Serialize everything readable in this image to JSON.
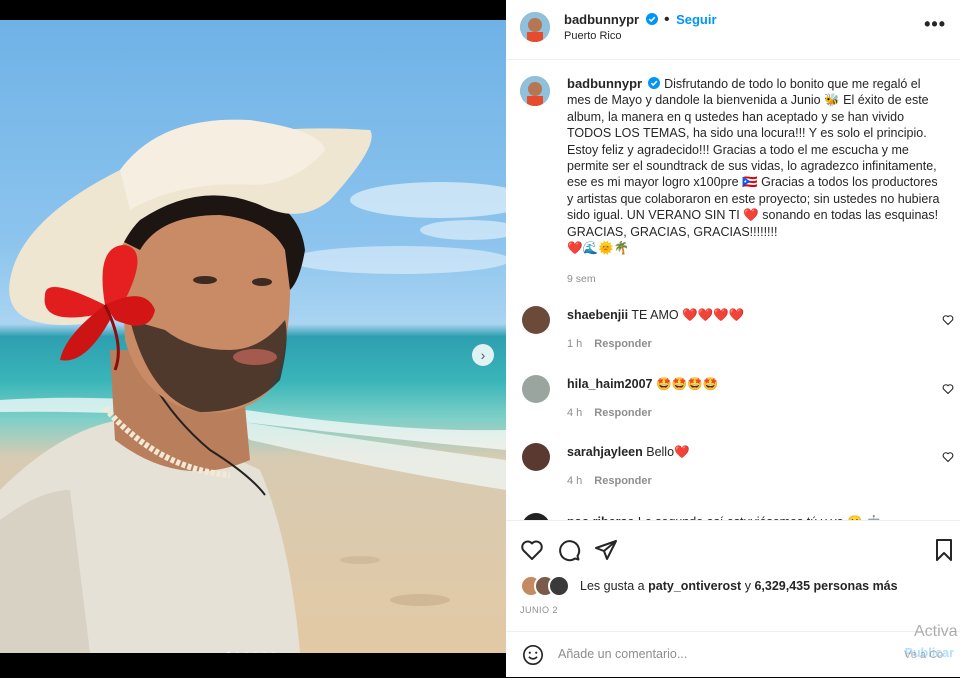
{
  "post": {
    "username": "badbunnypr",
    "follow_label": "Seguir",
    "location": "Puerto Rico",
    "more_label": "•••",
    "caption": "Disfrutando de todo lo bonito que me regaló el mes de Mayo y dandole la bienvenida a Junio 🐝 El éxito de este album, la manera en q ustedes han aceptado y se han vivido TODOS LOS TEMAS, ha sido una locura!!! Y es solo el principio. Estoy feliz y agradecido!!! Gracias a todo el me escucha y me permite ser el soundtrack de sus vidas, lo agradezco infinitamente, ese es mi mayor logro x100pre 🇵🇷 Gracias a todos los productores y artistas que colaboraron en este proyecto; sin ustedes no hubiera sido igual. UN VERANO SIN TI ❤️ sonando en todas las esquinas! GRACIAS, GRACIAS, GRACIAS!!!!!!!!",
    "caption_emoji": "❤️🌊🌞🌴",
    "caption_time": "9 sem",
    "carousel_dots": 6,
    "active_dot": 0
  },
  "comments": [
    {
      "user": "shaebenjii",
      "text": "TE AMO ❤️❤️❤️❤️",
      "time": "1 h",
      "reply": "Responder"
    },
    {
      "user": "hila_haim2007",
      "text": "🤩🤩🤩🤩",
      "time": "4 h",
      "reply": "Responder"
    },
    {
      "user": "sarahjayleen",
      "text": "Bello❤️",
      "time": "4 h",
      "reply": "Responder"
    },
    {
      "user": "pao.riberae",
      "text": "Lo segundo así estuviésemos tú y yo 🥲 🤖",
      "time": "",
      "reply": ""
    }
  ],
  "likes": {
    "prefix": "Les gusta a",
    "first_user": "paty_ontiverost",
    "connector": "y",
    "count_text": "6,329,435 personas más"
  },
  "date_label": "JUNIO 2",
  "add_comment": {
    "placeholder": "Añade un comentario...",
    "publish_label": "Publicar"
  },
  "watermark": {
    "line1": "Activa",
    "line2": "Ve a Co"
  },
  "colors": {
    "accent": "#0095f6",
    "heart": "#ed4956",
    "muted": "#8e8e8e"
  },
  "icons": [
    "verified-badge-icon",
    "more-options-icon",
    "like-heart-icon",
    "comment-icon",
    "share-icon",
    "save-bookmark-icon",
    "emoji-icon",
    "carousel-next-icon"
  ]
}
